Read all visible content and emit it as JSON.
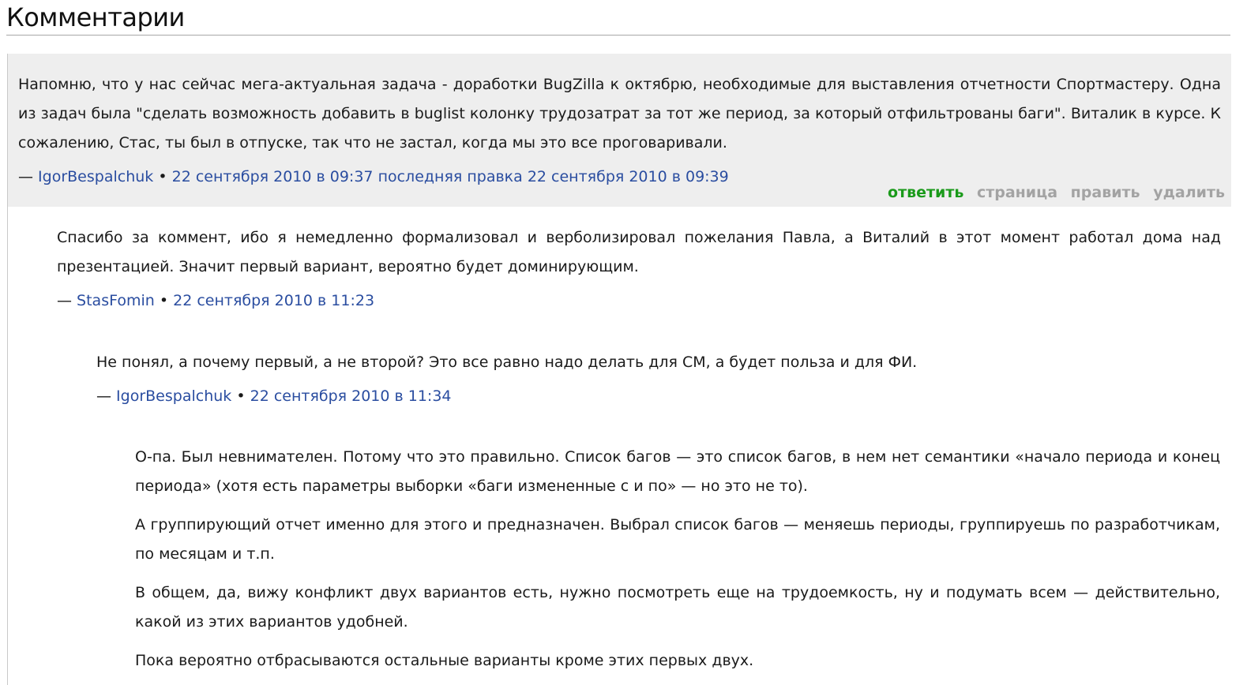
{
  "page": {
    "title": "Комментарии"
  },
  "comments": [
    {
      "text": [
        "Напомню, что у нас сейчас мега-актуальная задача - доработки BugZilla к октябрю, необходимые для выставления отчетности Спортмастеру. Одна из задач была \"сделать возможность добавить в buglist колонку трудозатрат за тот же период, за который отфильтрованы баги\". Виталик в курсе. К сожалению, Стас, ты был в отпуске, так что не застал, когда мы это все проговаривали."
      ],
      "dash": "—",
      "author": "IgorBespalchuk",
      "separator": "•",
      "date": "22 сентября 2010 в 09:37",
      "edited": "последняя правка 22 сентября 2010 в 09:39",
      "actions": {
        "reply": "ответить",
        "page": "страница",
        "edit": "править",
        "delete": "удалить"
      }
    },
    {
      "text": [
        "Спасибо за коммент, ибо я немедленно формализовал и верболизировал пожелания Павла, а Виталий в этот момент работал дома над презентацией. Значит первый вариант, вероятно будет доминирующим."
      ],
      "dash": "—",
      "author": "StasFomin",
      "separator": "•",
      "date": "22 сентября 2010 в 11:23"
    },
    {
      "text": [
        "Не понял, а почему первый, а не второй? Это все равно надо делать для СМ, а будет польза и для ФИ."
      ],
      "dash": "—",
      "author": "IgorBespalchuk",
      "separator": "•",
      "date": "22 сентября 2010 в 11:34"
    },
    {
      "text": [
        "О-па. Был невнимателен. Потому что это правильно. Список багов — это список багов, в нем нет семантики «начало периода и конец периода» (хотя есть параметры выборки «баги измененные с и по» — но это не то).",
        "А группирующий отчет именно для этого и предназначен. Выбрал список багов — меняешь периоды, группируешь по разработчикам, по месяцам и т.п.",
        "В общем, да, вижу конфликт двух вариантов есть, нужно посмотреть еще на трудоемкость, ну и подумать всем — действительно, какой из этих вариантов удобней.",
        "Пока вероятно отбрасываются остальные варианты кроме этих первых двух."
      ]
    }
  ]
}
